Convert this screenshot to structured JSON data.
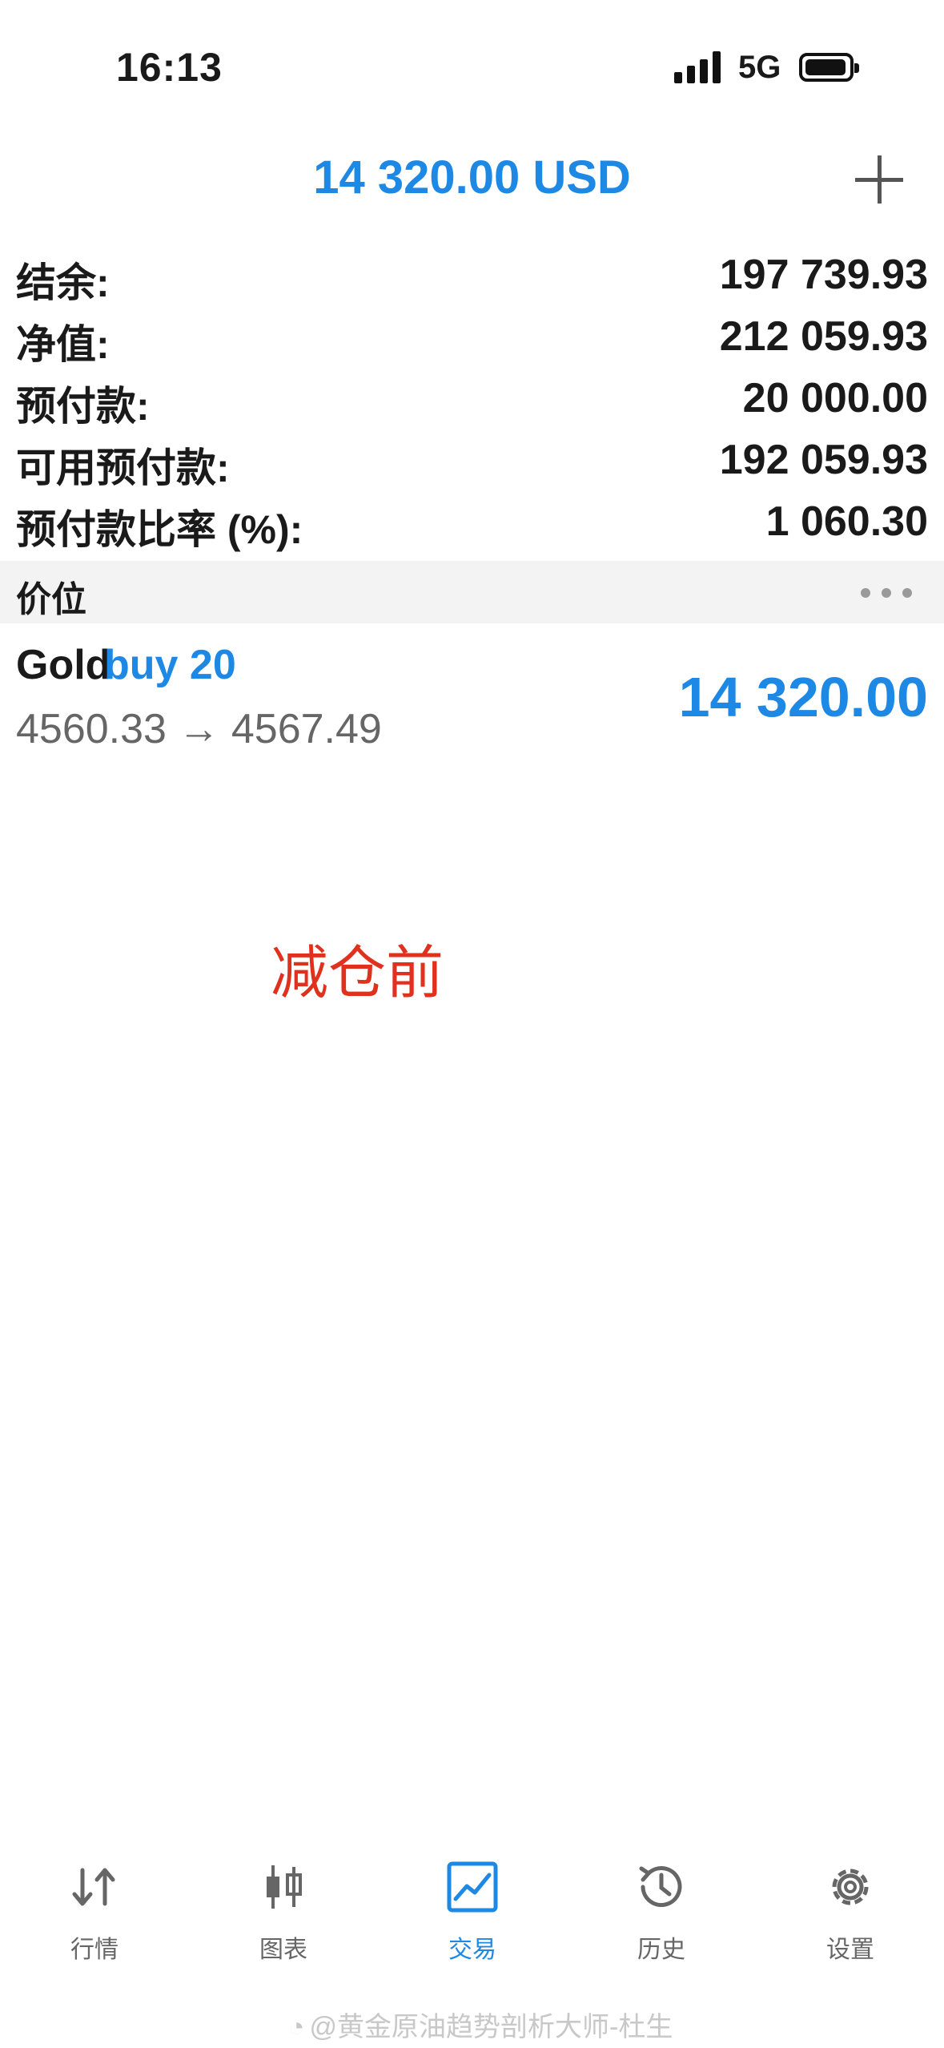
{
  "status_bar": {
    "time": "16:13",
    "network": "5G"
  },
  "header": {
    "title": "14 320.00 USD"
  },
  "summary": [
    {
      "label": "结余:",
      "value": "197 739.93"
    },
    {
      "label": "净值:",
      "value": "212 059.93"
    },
    {
      "label": "预付款:",
      "value": "20 000.00"
    },
    {
      "label": "可用预付款:",
      "value": "192 059.93"
    },
    {
      "label": "预付款比率 (%):",
      "value": "1 060.30"
    }
  ],
  "section": {
    "title": "价位"
  },
  "position": {
    "symbol": "Gold",
    "direction": "buy 20",
    "prices": "4560.33 → 4567.49",
    "profit": "14 320.00"
  },
  "annotation": "减仓前",
  "tabs": [
    {
      "label": "行情",
      "icon": "quotes-icon"
    },
    {
      "label": "图表",
      "icon": "chart-candles-icon"
    },
    {
      "label": "交易",
      "icon": "trade-icon",
      "active": true
    },
    {
      "label": "历史",
      "icon": "history-icon"
    },
    {
      "label": "设置",
      "icon": "settings-icon"
    }
  ],
  "watermark": "@黄金原油趋势剖析大师-杜生",
  "colors": {
    "accent": "#1e88e5",
    "annotation": "#e0301e",
    "section_bg": "#f3f3f3"
  }
}
